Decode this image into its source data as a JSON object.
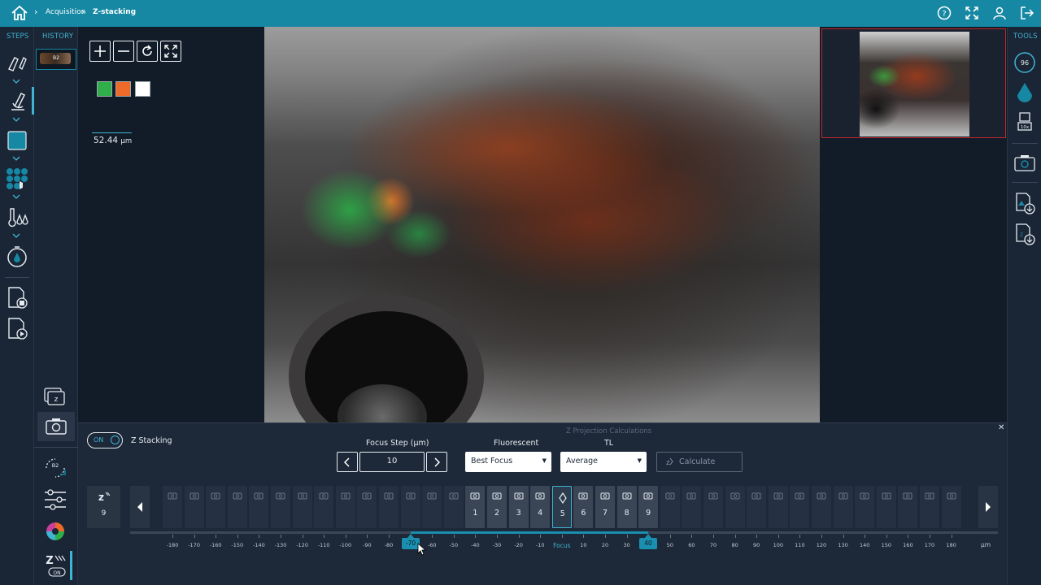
{
  "header": {
    "breadcrumb": [
      "Acquisition",
      "Z-stacking"
    ],
    "icons": [
      "home-icon",
      "help-icon",
      "full-screen-icon",
      "user-icon",
      "logout-icon"
    ]
  },
  "steps_panel": {
    "title": "STEPS",
    "icons": [
      "microscope-objective-icon",
      "microscope-icon",
      "field-square-icon",
      "wellplate-hand-icon",
      "temperature-humidity-icon",
      "timer-drop-icon",
      "document-save-icon",
      "document-play-icon"
    ]
  },
  "history_panel": {
    "title": "HISTORY",
    "thumbnail_label": "B2"
  },
  "zoom_controls": [
    "+",
    "−",
    "⟳",
    "⤢"
  ],
  "channels": [
    {
      "name": "green",
      "color": "#2fae4a"
    },
    {
      "name": "orange",
      "color": "#ee6a28"
    },
    {
      "name": "white",
      "color": "#ffffff"
    }
  ],
  "scale_bar": {
    "value": "52.44",
    "unit": "µm"
  },
  "tools_panel": {
    "title": "TOOLS",
    "badge": "96",
    "objective_label": "10x"
  },
  "bottom_left_tools": {
    "icons": [
      "z-stack-capture-icon",
      "capture-icon",
      "b2-autofocus-icon",
      "adjust-sliders-icon",
      "color-palette-icon",
      "z-stack-on-icon"
    ],
    "position_label": "B2",
    "zstack_badge": "ON"
  },
  "zstack": {
    "toggle_label": "ON",
    "title": "Z Stacking",
    "projection_header": "Z Projection Calculations",
    "focus_step_label": "Focus Step (µm)",
    "focus_step_value": "10",
    "fluorescent_label": "Fluorescent",
    "fluorescent_value": "Best Focus",
    "tl_label": "TL",
    "tl_value": "Average",
    "calculate_label": "Calculate",
    "count": "9",
    "focus_label": "Focus",
    "unit": "µm",
    "range_low": "-70",
    "range_high": "40",
    "slots": [
      "",
      "",
      "",
      "",
      "",
      "",
      "",
      "",
      "",
      "",
      "",
      "",
      "",
      "",
      "1",
      "2",
      "3",
      "4",
      "5",
      "6",
      "7",
      "8",
      "9",
      "",
      "",
      "",
      "",
      "",
      "",
      "",
      "",
      "",
      "",
      "",
      "",
      "",
      ""
    ],
    "ticks": [
      "-180",
      "-170",
      "-160",
      "-150",
      "-140",
      "-130",
      "-120",
      "-110",
      "-100",
      "-90",
      "-80",
      "-70",
      "-60",
      "-50",
      "-40",
      "-30",
      "-20",
      "-10",
      "Focus",
      "10",
      "20",
      "30",
      "40",
      "50",
      "60",
      "70",
      "80",
      "90",
      "100",
      "110",
      "120",
      "130",
      "140",
      "150",
      "160",
      "170",
      "180"
    ]
  },
  "colors": {
    "accent": "#1688a3",
    "panel": "#1a2535",
    "highlight": "#3fb5d3"
  }
}
